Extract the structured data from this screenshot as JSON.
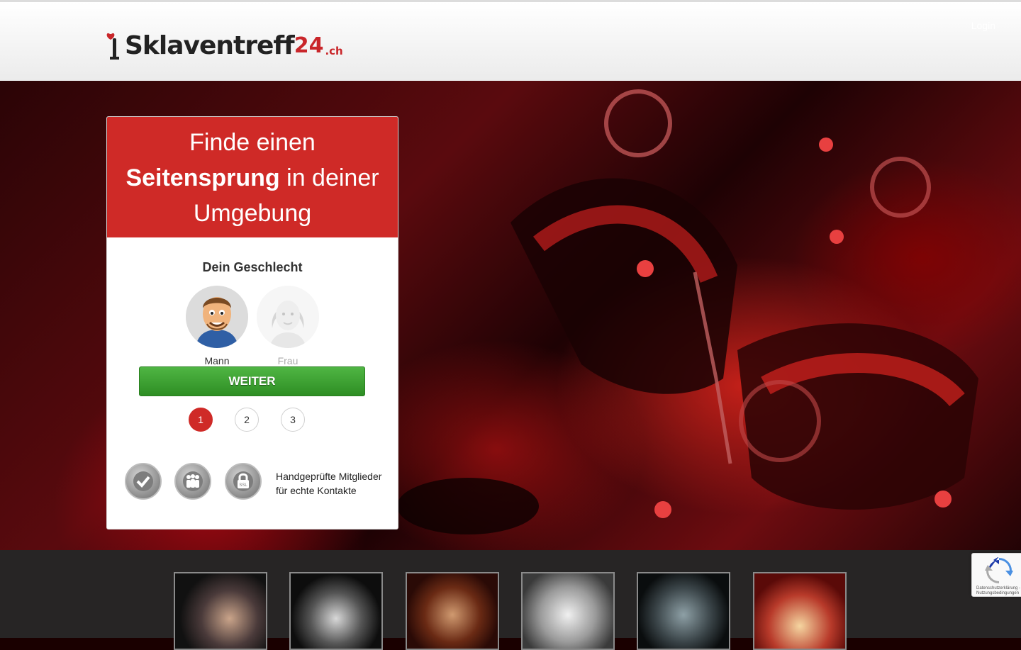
{
  "header": {
    "logo_text": "Sklaventreff",
    "logo_number": "24",
    "logo_tld": ".ch",
    "login_label": "Login"
  },
  "signup": {
    "headline_line1": "Finde einen",
    "headline_bold": "Seitensprung",
    "headline_line2_rest": " in deiner",
    "headline_line3": "Umgebung",
    "gender_label": "Dein Geschlecht",
    "genders": [
      {
        "label": "Mann",
        "selected": true
      },
      {
        "label": "Frau",
        "selected": false
      }
    ],
    "continue_label": "WEITER",
    "steps": [
      "1",
      "2",
      "3"
    ],
    "active_step": "1",
    "trust_badges": [
      "checkmark-badge-icon",
      "members-badge-icon",
      "ssl-lock-badge-icon"
    ],
    "ssl_label": "SSL",
    "trust_text": "Handgeprüfte Mitglieder für echte Kontakte"
  },
  "profiles": [
    {
      "name": "profile-thumb-1"
    },
    {
      "name": "profile-thumb-2"
    },
    {
      "name": "profile-thumb-3"
    },
    {
      "name": "profile-thumb-4"
    },
    {
      "name": "profile-thumb-5"
    },
    {
      "name": "profile-thumb-6"
    }
  ],
  "recaptcha": {
    "text": "Datenschutzerklärung - Nutzungsbedingungen"
  },
  "colors": {
    "accent_red": "#cf2a27",
    "button_green": "#3fa535"
  }
}
